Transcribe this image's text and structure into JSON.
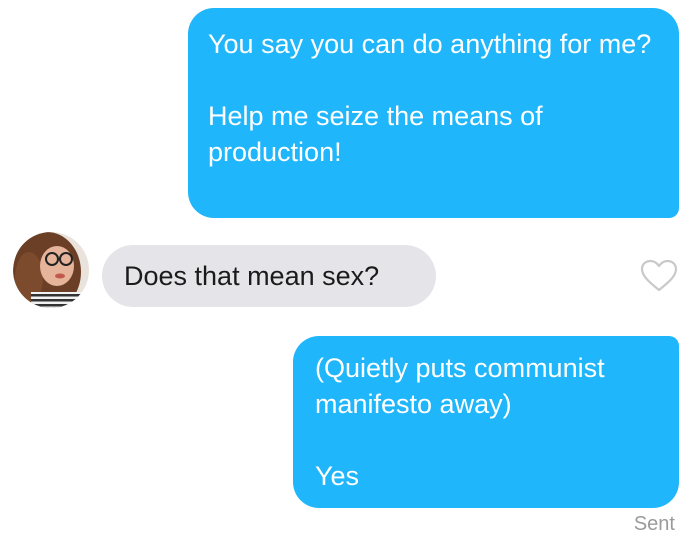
{
  "conversation": {
    "messages": [
      {
        "direction": "outgoing",
        "text": "You say you can do anything for me?\n\nHelp me seize the means of production!"
      },
      {
        "direction": "incoming",
        "text": "Does that mean sex?"
      },
      {
        "direction": "outgoing",
        "text": "(Quietly puts communist manifesto away)\n\nYes"
      }
    ],
    "status_text": "Sent"
  },
  "icons": {
    "avatar": "profile-photo",
    "like": "heart-outline-icon"
  },
  "colors": {
    "outgoing_bubble": "#1fb6fb",
    "incoming_bubble": "#e5e5e9",
    "status_text": "#9a9a9a"
  }
}
